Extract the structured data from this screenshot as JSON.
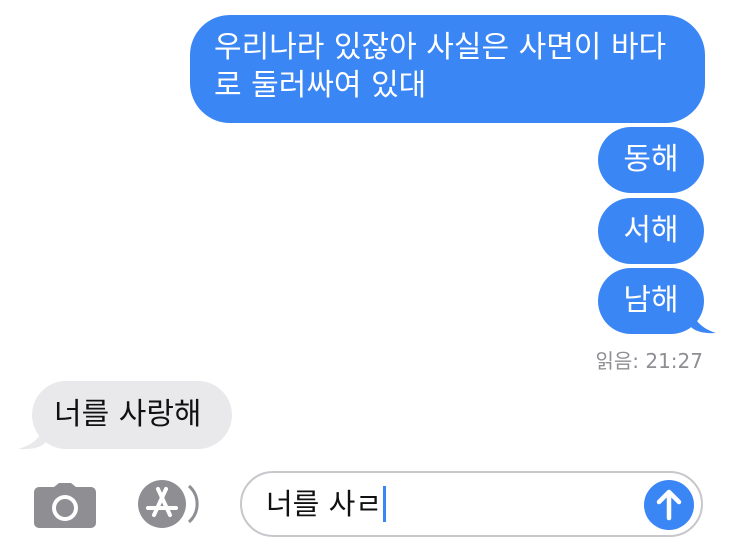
{
  "colors": {
    "sent_bubble": "#3b86f5",
    "received_bubble": "#e9e9eb",
    "receipt_text": "#8e8e93",
    "input_border": "#c7c7cc"
  },
  "messages": {
    "sent_1_line_1": "우리나라 있잖아 사실은 사면이 바다",
    "sent_1_line_2": "로 둘러싸여 있대",
    "sent_2": "동해",
    "sent_3": "서해",
    "sent_4": "남해",
    "received_1": "너를 사랑해"
  },
  "read_receipt": "읽음: 21:27",
  "composer": {
    "camera_icon": "camera-icon",
    "apps_icon": "app-store-icon",
    "input_value": "너를 사ㄹ",
    "send_icon": "arrow-up-icon"
  }
}
